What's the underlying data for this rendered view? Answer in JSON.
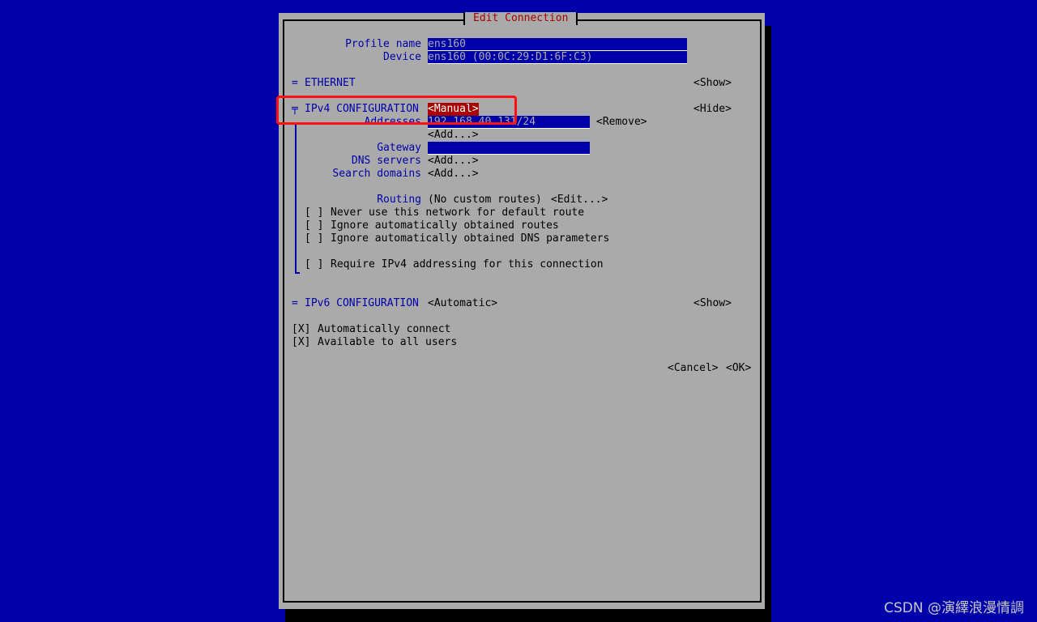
{
  "dialog": {
    "title": "Edit Connection"
  },
  "profile": {
    "label": "Profile name",
    "value": "ens160"
  },
  "device": {
    "label": "Device",
    "value": "ens160 (00:0C:29:D1:6F:C3)"
  },
  "ethernet": {
    "marker": "=",
    "label": "ETHERNET",
    "toggle": "<Show>"
  },
  "ipv4": {
    "marker": "╤",
    "label": "IPv4 CONFIGURATION",
    "mode": "<Manual>",
    "toggle": "<Hide>",
    "addresses_label": "Addresses",
    "address_value": "192.168.40.131/24",
    "remove": "<Remove>",
    "add": "<Add...>",
    "gateway_label": "Gateway",
    "gateway_value": "",
    "dns_label": "DNS servers",
    "dns_add": "<Add...>",
    "search_label": "Search domains",
    "search_add": "<Add...>",
    "routing_label": "Routing",
    "routing_value": "(No custom routes)",
    "routing_edit": "<Edit...>",
    "options": [
      {
        "box": "[ ]",
        "label": "Never use this network for default route"
      },
      {
        "box": "[ ]",
        "label": "Ignore automatically obtained routes"
      },
      {
        "box": "[ ]",
        "label": "Ignore automatically obtained DNS parameters"
      },
      {
        "box": "[ ]",
        "label": "Require IPv4 addressing for this connection"
      }
    ]
  },
  "ipv6": {
    "marker": "=",
    "label": "IPv6 CONFIGURATION",
    "mode": "<Automatic>",
    "toggle": "<Show>"
  },
  "general": [
    {
      "box": "[X]",
      "label": "Automatically connect"
    },
    {
      "box": "[X]",
      "label": "Available to all users"
    }
  ],
  "buttons": {
    "cancel": "<Cancel>",
    "ok": "<OK>"
  },
  "watermark": "CSDN @演繹浪漫情調",
  "colors": {
    "background": "#0000aa",
    "dialog": "#aaaaaa",
    "title": "#aa0000",
    "highlight": "#ff1010"
  }
}
